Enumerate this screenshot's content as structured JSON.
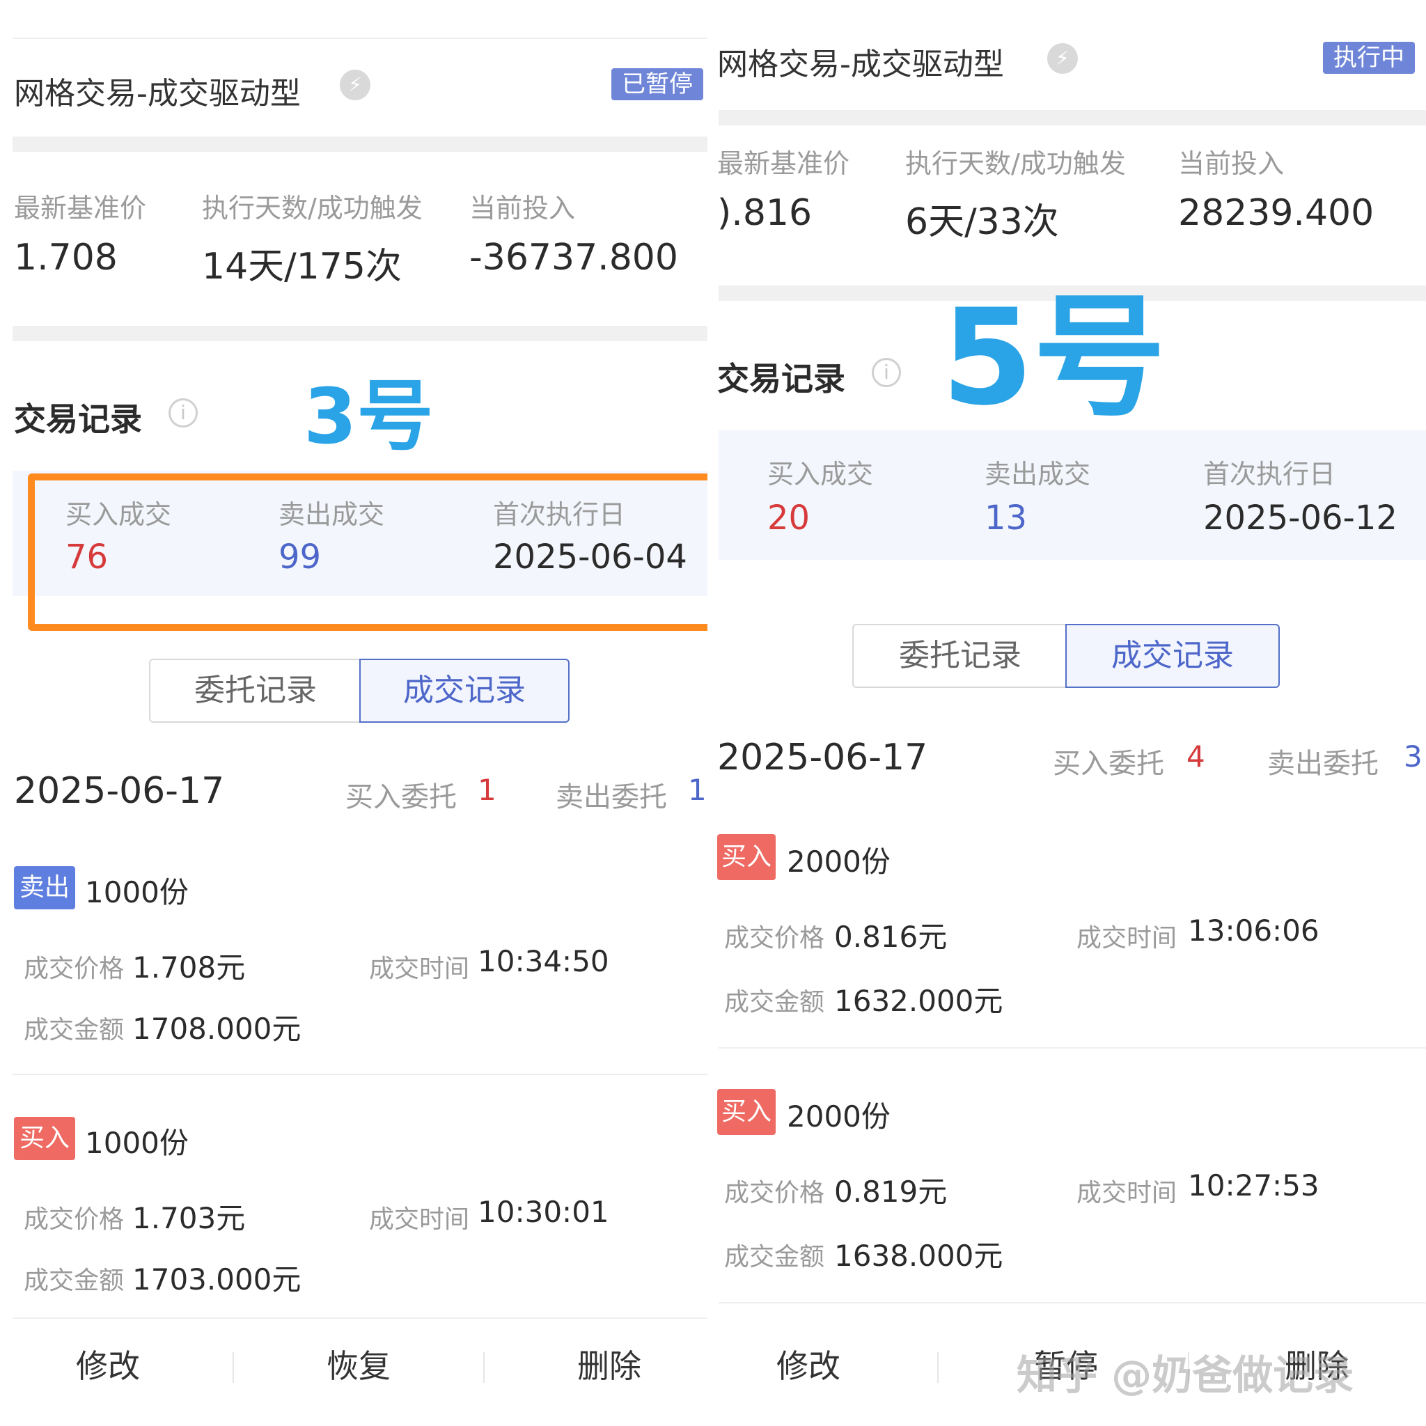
{
  "left": {
    "title": "网格交易-成交驱动型",
    "lightning_icon": "lightning-icon",
    "status": "已暂停",
    "stats": {
      "base_price_label": "最新基准价",
      "base_price": "1.708",
      "exec_label": "执行天数/成功触发",
      "exec_value": "14天/175次",
      "invest_label": "当前投入",
      "invest_value": "-36737.800"
    },
    "records_title": "交易记录",
    "info_icon": "info-icon",
    "annotation": "3号",
    "summary": {
      "buy_label": "买入成交",
      "buy_value": "76",
      "sell_label": "卖出成交",
      "sell_value": "99",
      "first_label": "首次执行日",
      "first_value": "2025-06-04"
    },
    "tabs": {
      "order": "委托记录",
      "deal": "成交记录"
    },
    "date": "2025-06-17",
    "buy_order_label": "买入委托",
    "buy_order_count": "1",
    "sell_order_label": "卖出委托",
    "sell_order_count": "1",
    "trades": [
      {
        "tag": "卖出",
        "shares": "1000份",
        "price_label": "成交价格",
        "price": "1.708元",
        "time_label": "成交时间",
        "time": "10:34:50",
        "amount_label": "成交金额",
        "amount": "1708.000元"
      },
      {
        "tag": "买入",
        "shares": "1000份",
        "price_label": "成交价格",
        "price": "1.703元",
        "time_label": "成交时间",
        "time": "10:30:01",
        "amount_label": "成交金额",
        "amount": "1703.000元"
      }
    ],
    "buttons": {
      "edit": "修改",
      "resume": "恢复",
      "delete": "删除"
    }
  },
  "right": {
    "title": "网格交易-成交驱动型",
    "lightning_icon": "lightning-icon",
    "status": "执行中",
    "stats": {
      "base_price_label": "最新基准价",
      "base_price": ").816",
      "exec_label": "执行天数/成功触发",
      "exec_value": "6天/33次",
      "invest_label": "当前投入",
      "invest_value": "28239.400"
    },
    "records_title": "交易记录",
    "info_icon": "info-icon",
    "annotation": "5号",
    "summary": {
      "buy_label": "买入成交",
      "buy_value": "20",
      "sell_label": "卖出成交",
      "sell_value": "13",
      "first_label": "首次执行日",
      "first_value": "2025-06-12"
    },
    "tabs": {
      "order": "委托记录",
      "deal": "成交记录"
    },
    "date": "2025-06-17",
    "buy_order_label": "买入委托",
    "buy_order_count": "4",
    "sell_order_label": "卖出委托",
    "sell_order_count": "3",
    "trades": [
      {
        "tag": "买入",
        "shares": "2000份",
        "price_label": "成交价格",
        "price": "0.816元",
        "time_label": "成交时间",
        "time": "13:06:06",
        "amount_label": "成交金额",
        "amount": "1632.000元"
      },
      {
        "tag": "买入",
        "shares": "2000份",
        "price_label": "成交价格",
        "price": "0.819元",
        "time_label": "成交时间",
        "time": "10:27:53",
        "amount_label": "成交金额",
        "amount": "1638.000元"
      }
    ],
    "buttons": {
      "edit": "修改",
      "pause": "暂停",
      "delete": "删除"
    }
  },
  "watermark": "知乎 @奶爸做记录",
  "colors": {
    "buy_red": "#d63a3a",
    "sell_blue": "#4d66c9",
    "highlight_orange": "#ff8a1f",
    "annotation_blue": "#2aa4e6",
    "status_badge": "#6f86d8"
  }
}
